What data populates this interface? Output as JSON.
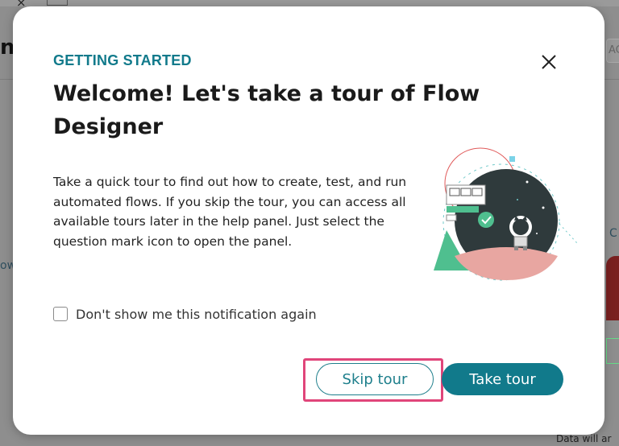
{
  "background": {
    "title_fragment": "n",
    "search_fragment": "ACT",
    "left_fragment": "ow",
    "right_fragment": "C",
    "bottom_fragment": "Data will ar"
  },
  "modal": {
    "eyebrow": "GETTING STARTED",
    "title": "Welcome! Let's take a tour of Flow Designer",
    "description": "Take a quick tour to find out how to create, test, and run automated flows. If you skip the tour, you can access all available tours later in the help panel. Just select the question mark icon to open the panel.",
    "checkbox_label": "Don't show me this notification again",
    "checkbox_checked": false,
    "skip_label": "Skip tour",
    "take_label": "Take tour"
  },
  "colors": {
    "accent": "#117a8b",
    "highlight": "#e0457a"
  },
  "icons": {
    "close": "close-icon",
    "illustration": "robot-space-illustration"
  }
}
